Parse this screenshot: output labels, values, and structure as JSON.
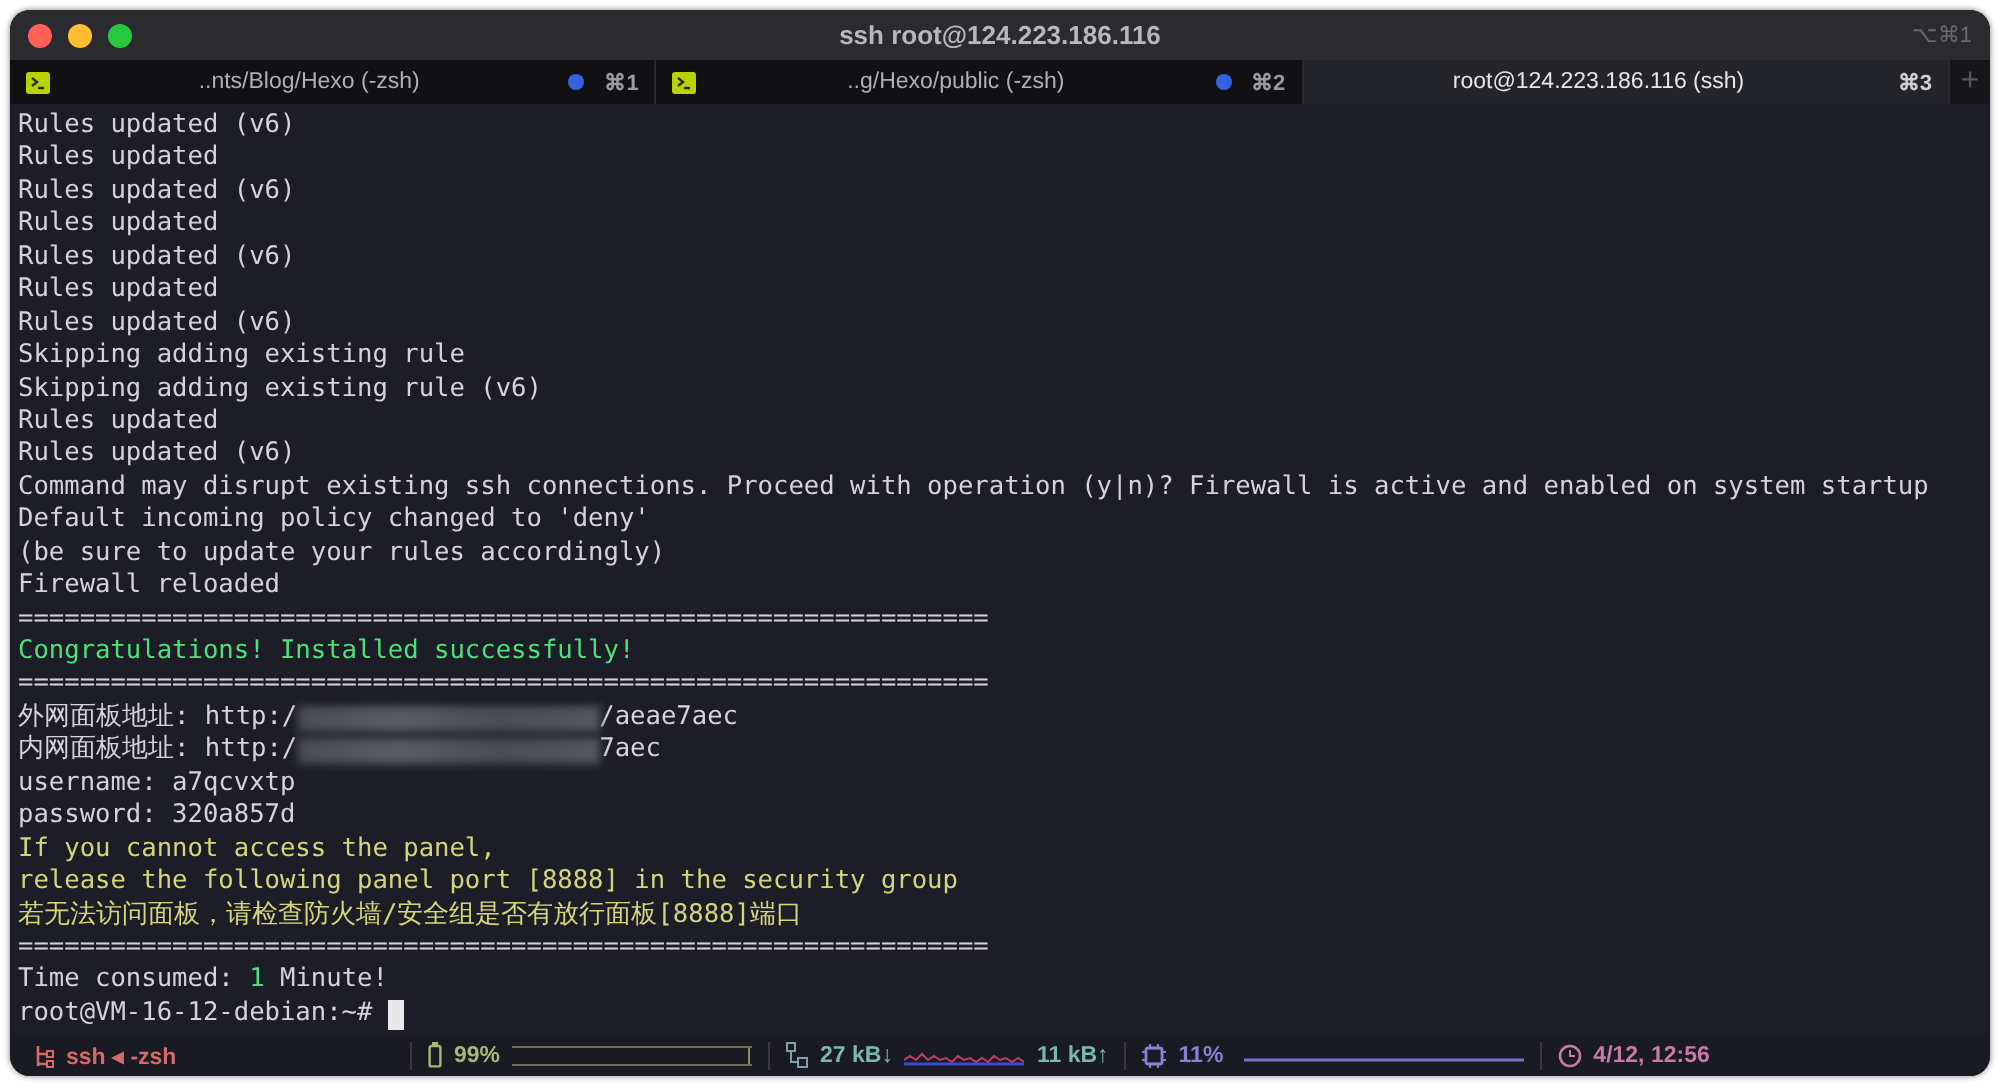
{
  "window": {
    "title": "ssh root@124.223.186.116",
    "shortcut": "⌥⌘1"
  },
  "tabs": [
    {
      "label": "..nts/Blog/Hexo (-zsh)",
      "shortcut": "⌘1",
      "activity": true,
      "selected": false
    },
    {
      "label": "..g/Hexo/public (-zsh)",
      "shortcut": "⌘2",
      "activity": true,
      "selected": false
    },
    {
      "label": "root@124.223.186.116 (ssh)",
      "shortcut": "⌘3",
      "activity": false,
      "selected": true
    }
  ],
  "new_tab": {
    "label": "+"
  },
  "terminal": {
    "lines": [
      [
        {
          "text": "Rules updated (v6)",
          "kind": "plain"
        }
      ],
      [
        {
          "text": "Rules updated",
          "kind": "plain"
        }
      ],
      [
        {
          "text": "Rules updated (v6)",
          "kind": "plain"
        }
      ],
      [
        {
          "text": "Rules updated",
          "kind": "plain"
        }
      ],
      [
        {
          "text": "Rules updated (v6)",
          "kind": "plain"
        }
      ],
      [
        {
          "text": "Rules updated",
          "kind": "plain"
        }
      ],
      [
        {
          "text": "Rules updated (v6)",
          "kind": "plain"
        }
      ],
      [
        {
          "text": "Skipping adding existing rule",
          "kind": "plain"
        }
      ],
      [
        {
          "text": "Skipping adding existing rule (v6)",
          "kind": "plain"
        }
      ],
      [
        {
          "text": "Rules updated",
          "kind": "plain"
        }
      ],
      [
        {
          "text": "Rules updated (v6)",
          "kind": "plain"
        }
      ],
      [
        {
          "text": "Command may disrupt existing ssh connections. Proceed with operation (y|n)? Firewall is active and enabled on system startup",
          "kind": "plain"
        }
      ],
      [
        {
          "text": "Default incoming policy changed to 'deny'",
          "kind": "plain"
        }
      ],
      [
        {
          "text": "(be sure to update your rules accordingly)",
          "kind": "plain"
        }
      ],
      [
        {
          "text": "Firewall reloaded",
          "kind": "plain"
        }
      ],
      [
        {
          "text": "===============================================================",
          "kind": "plain"
        }
      ],
      [
        {
          "text": "Congratulations! Installed successfully!",
          "kind": "success"
        }
      ],
      [
        {
          "text": "===============================================================",
          "kind": "plain"
        }
      ],
      [
        {
          "text": "外网面板地址: http:/",
          "kind": "plain"
        },
        {
          "kind": "redacted"
        },
        {
          "text": "/aeae7aec",
          "kind": "plain"
        }
      ],
      [
        {
          "text": "内网面板地址: http:/",
          "kind": "plain"
        },
        {
          "kind": "redacted"
        },
        {
          "text": "7aec",
          "kind": "plain"
        }
      ],
      [
        {
          "text": "username: a7qcvxtp",
          "kind": "plain"
        }
      ],
      [
        {
          "text": "password: 320a857d",
          "kind": "plain"
        }
      ],
      [
        {
          "text": "If you cannot access the panel,",
          "kind": "warning"
        }
      ],
      [
        {
          "text": "release the following panel port [8888] in the security group",
          "kind": "warning"
        }
      ],
      [
        {
          "text": "若无法访问面板，请检查防火墙/安全组是否有放行面板[8888]端口",
          "kind": "warning"
        }
      ],
      [
        {
          "text": "===============================================================",
          "kind": "plain"
        }
      ],
      [
        {
          "text": "Time consumed: ",
          "kind": "plain"
        },
        {
          "text": "1",
          "kind": "success"
        },
        {
          "text": " Minute!",
          "kind": "plain"
        }
      ],
      [
        {
          "text": "root@VM-16-12-debian:~# ",
          "kind": "plain"
        },
        {
          "kind": "cursor"
        }
      ]
    ]
  },
  "status_bar": [
    {
      "kind": "job",
      "text": "ssh ◂ -zsh"
    },
    {
      "kind": "battery",
      "text": "99%",
      "level": 0.99
    },
    {
      "kind": "network",
      "down": "27 kB↓",
      "up": "11 kB↑"
    },
    {
      "kind": "cpu",
      "text": "11%"
    },
    {
      "kind": "clock",
      "text": "4/12, 12:56"
    }
  ]
}
